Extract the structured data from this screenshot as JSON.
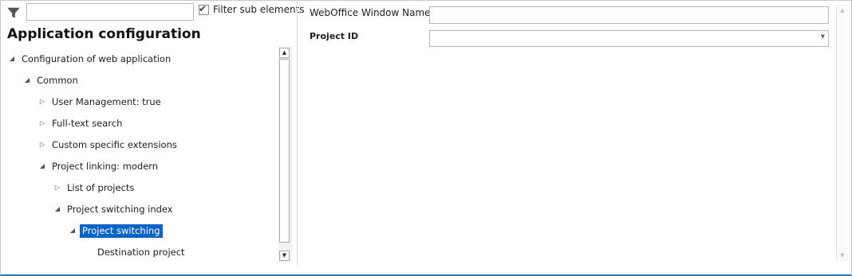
{
  "filter": {
    "value": "",
    "checkbox_label": "Filter sub elements",
    "checked": true
  },
  "title": "Application configuration",
  "tree": [
    {
      "label": "Configuration of web application",
      "toggle": "◢",
      "level": 0
    },
    {
      "label": "Common",
      "toggle": "◢",
      "level": 1
    },
    {
      "label": "User Management: true",
      "toggle": "▷",
      "level": 2
    },
    {
      "label": "Full-text search",
      "toggle": "▷",
      "level": 2
    },
    {
      "label": "Custom specific extensions",
      "toggle": "▷",
      "level": 2
    },
    {
      "label": "Project linking: modern",
      "toggle": "◢",
      "level": 2
    },
    {
      "label": "List of projects",
      "toggle": "▷",
      "level": 3
    },
    {
      "label": "Project switching index",
      "toggle": "◢",
      "level": 3
    },
    {
      "label": "Project switching",
      "toggle": "◢",
      "level": 4,
      "selected": true
    },
    {
      "label": "Destination project",
      "toggle": "",
      "level": 5
    }
  ],
  "form": {
    "window_name_label": "WebOffice Window Name",
    "window_name_value": "",
    "project_id_label": "Project ID",
    "project_id_value": ""
  },
  "icons": {
    "filter": "filter-funnel-icon",
    "scroll_up": "scroll-up-arrow-icon",
    "scroll_down": "scroll-down-arrow-icon",
    "dropdown": "chevron-down-icon"
  },
  "colors": {
    "selection": "#0a64c8",
    "accent_border": "#2b7bbf"
  }
}
